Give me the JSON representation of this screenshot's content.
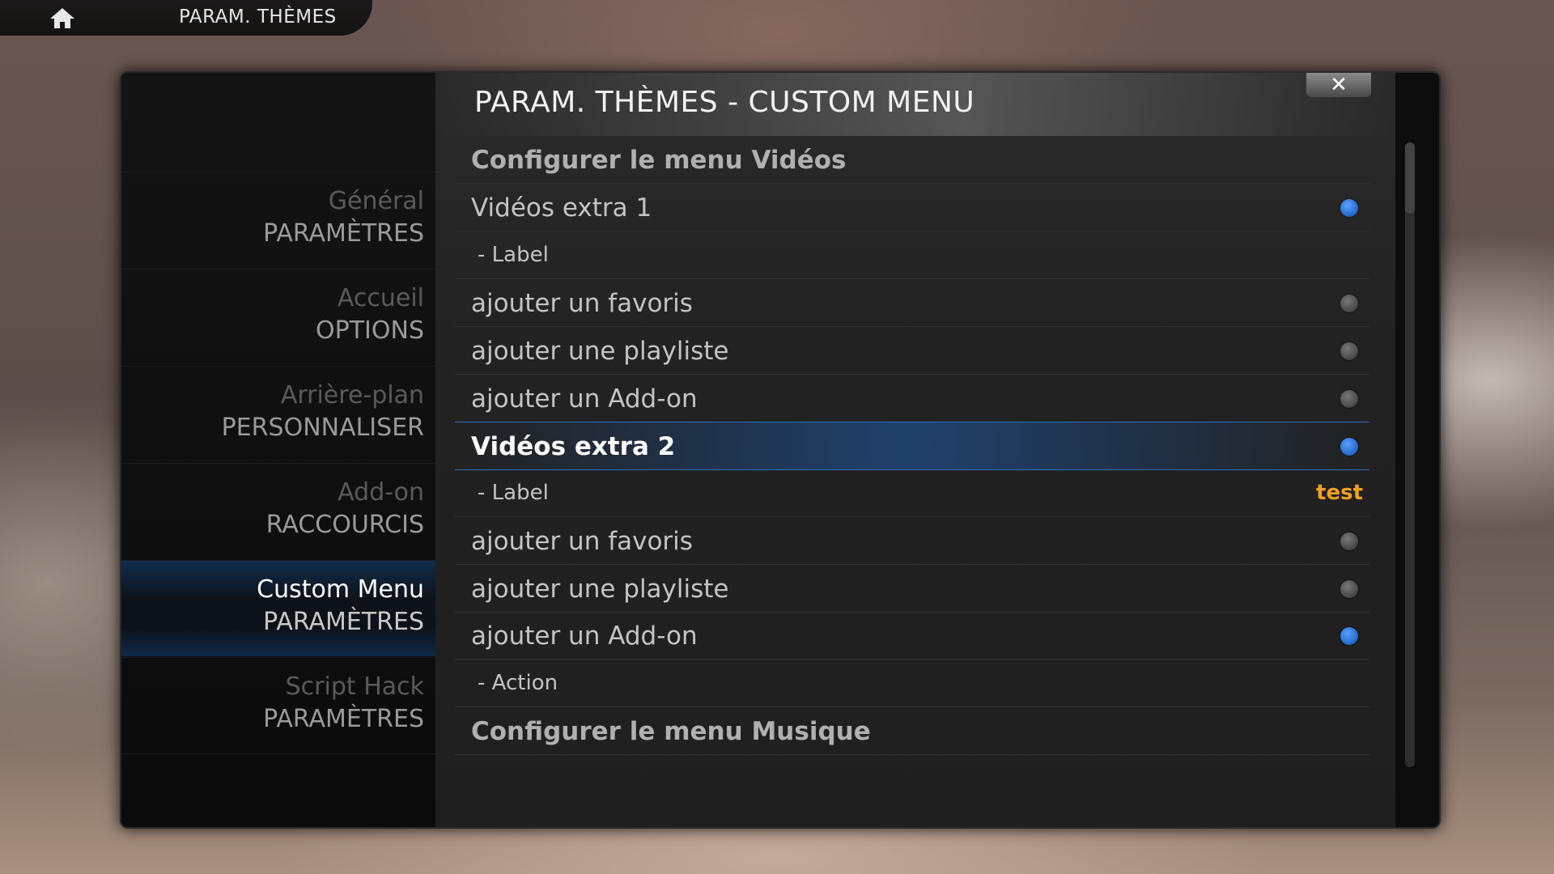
{
  "topbar": {
    "title": "PARAM. THÈMES"
  },
  "dialog": {
    "title": "PARAM. THÈMES - CUSTOM MENU"
  },
  "sidebar": {
    "items": [
      {
        "category": "Général",
        "label": "PARAMÈTRES",
        "active": false
      },
      {
        "category": "Accueil",
        "label": "OPTIONS",
        "active": false
      },
      {
        "category": "Arrière-plan",
        "label": "PERSONNALISER",
        "active": false
      },
      {
        "category": "Add-on",
        "label": "RACCOURCIS",
        "active": false
      },
      {
        "category": "Custom Menu",
        "label": "PARAMÈTRES",
        "active": true
      },
      {
        "category": "Script Hack",
        "label": "PARAMÈTRES",
        "active": false
      }
    ]
  },
  "settings": {
    "rows": [
      {
        "text": "Configurer le menu  Vidéos",
        "kind": "header"
      },
      {
        "text": "Vidéos extra 1",
        "kind": "toggle",
        "on": true
      },
      {
        "text": "- Label",
        "kind": "sub",
        "value": ""
      },
      {
        "text": "ajouter un favoris",
        "kind": "toggle",
        "on": false
      },
      {
        "text": "ajouter une playliste",
        "kind": "toggle",
        "on": false
      },
      {
        "text": "ajouter un Add-on",
        "kind": "toggle",
        "on": false
      },
      {
        "text": "Vidéos extra 2",
        "kind": "toggle",
        "on": true,
        "selected": true
      },
      {
        "text": "- Label",
        "kind": "sub",
        "value": "test"
      },
      {
        "text": "ajouter un favoris",
        "kind": "toggle",
        "on": false
      },
      {
        "text": "ajouter une playliste",
        "kind": "toggle",
        "on": false
      },
      {
        "text": "ajouter un Add-on",
        "kind": "toggle",
        "on": true
      },
      {
        "text": "- Action",
        "kind": "sub",
        "value": ""
      },
      {
        "text": "Configurer le menu  Musique",
        "kind": "header"
      }
    ]
  },
  "colors": {
    "accent": "#1f6fd0",
    "value": "#f0a020"
  },
  "icons": {
    "home": "home-icon",
    "close": "close-icon"
  }
}
